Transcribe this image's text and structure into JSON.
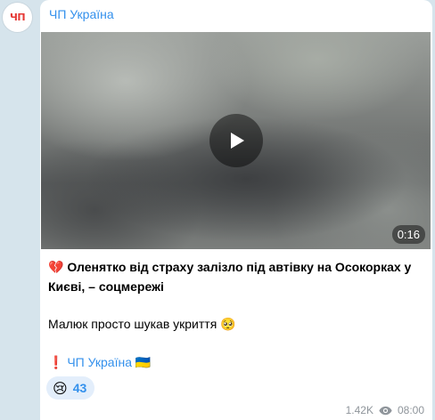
{
  "channel": {
    "name": "ЧП Україна",
    "avatar_text": "ЧП"
  },
  "video": {
    "duration": "0:16"
  },
  "post": {
    "headline_emoji": "💔",
    "headline": "Оленятко від страху залізло під автівку на Осокорках у Києві, – соцмережі",
    "body": "Малюк просто шукав укриття",
    "body_emoji": "🥺",
    "link_prefix_emoji": "❗",
    "link_text": "ЧП Україна",
    "link_suffix_emoji": "🇺🇦"
  },
  "reactions": [
    {
      "emoji": "😢",
      "count": "43"
    }
  ],
  "meta": {
    "views": "1.42K",
    "time": "08:00"
  },
  "colors": {
    "accent": "#3390ec",
    "background": "#d6e4ec",
    "avatar_logo": "#e53935",
    "muted": "#8f959b"
  }
}
